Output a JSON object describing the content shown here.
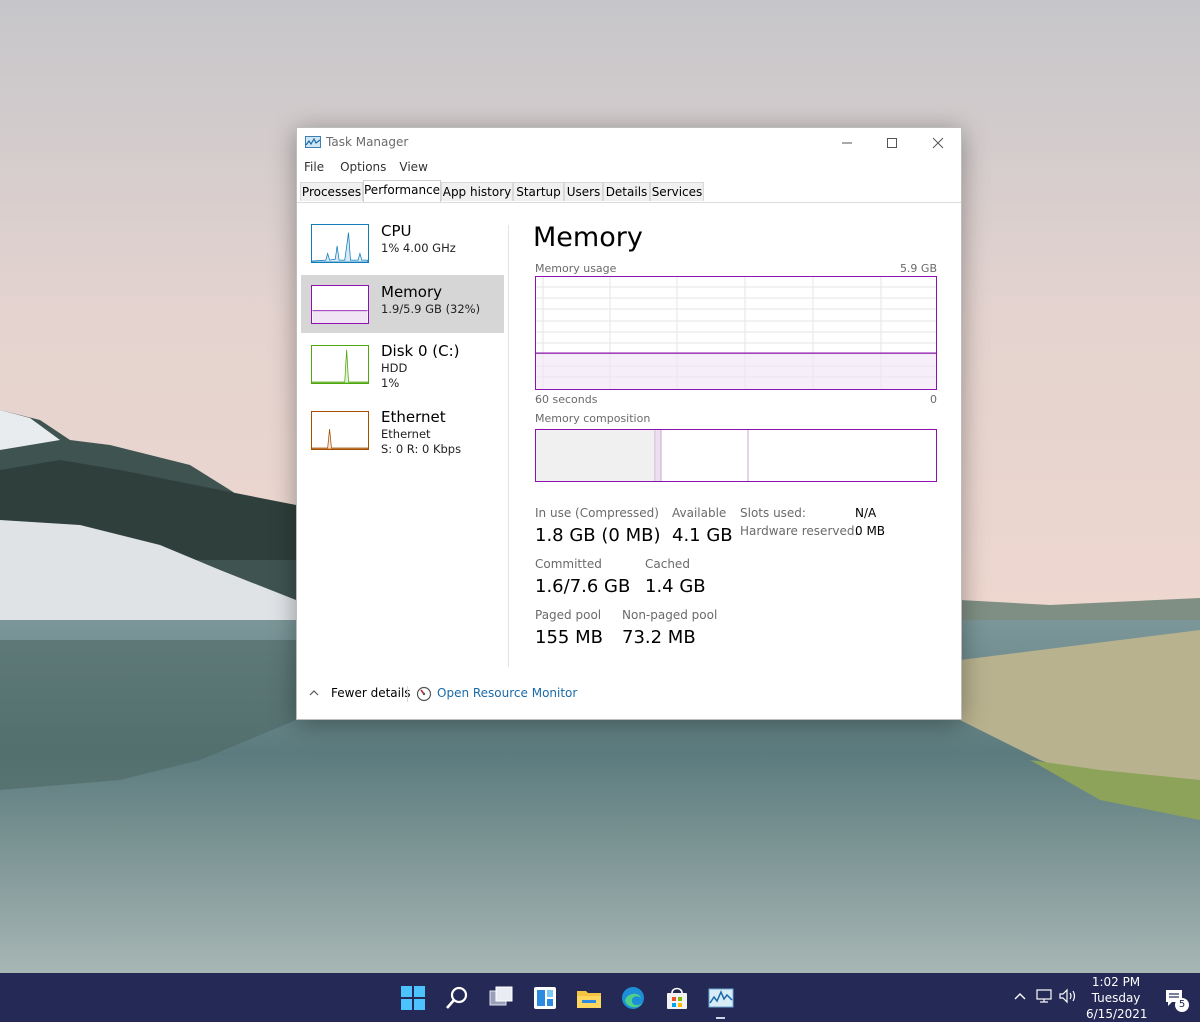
{
  "window": {
    "title": "Task Manager",
    "menu": [
      "File",
      "Options",
      "View"
    ],
    "tabs": [
      {
        "label": "Processes",
        "active": false
      },
      {
        "label": "Performance",
        "active": true
      },
      {
        "label": "App history",
        "active": false
      },
      {
        "label": "Startup",
        "active": false
      },
      {
        "label": "Users",
        "active": false
      },
      {
        "label": "Details",
        "active": false
      },
      {
        "label": "Services",
        "active": false
      }
    ]
  },
  "sidebar": {
    "items": [
      {
        "name": "CPU",
        "line1": "1% 4.00 GHz",
        "line2": "",
        "color": "#117dbb"
      },
      {
        "name": "Memory",
        "line1": "1.9/5.9 GB (32%)",
        "line2": "",
        "color": "#8b12ae",
        "selected": true
      },
      {
        "name": "Disk 0 (C:)",
        "line1": "HDD",
        "line2": "1%",
        "color": "#4da60c"
      },
      {
        "name": "Ethernet",
        "line1": "Ethernet",
        "line2": "S: 0 R: 0 Kbps",
        "color": "#a74f01"
      }
    ]
  },
  "main": {
    "title": "Memory",
    "usage_label": "Memory usage",
    "usage_max": "5.9 GB",
    "time_label": "60 seconds",
    "time_end": "0",
    "composition_label": "Memory composition",
    "usage_fraction": 0.32,
    "stats": {
      "in_use_label": "In use (Compressed)",
      "in_use_value": "1.8 GB (0 MB)",
      "available_label": "Available",
      "available_value": "4.1 GB",
      "slots_label": "Slots used:",
      "slots_value": "N/A",
      "hw_reserved_label": "Hardware reserved:",
      "hw_reserved_value": "0 MB",
      "committed_label": "Committed",
      "committed_value": "1.6/7.6 GB",
      "cached_label": "Cached",
      "cached_value": "1.4 GB",
      "paged_label": "Paged pool",
      "paged_value": "155 MB",
      "nonpaged_label": "Non-paged pool",
      "nonpaged_value": "73.2 MB"
    }
  },
  "footer": {
    "fewer_details": "Fewer details",
    "open_monitor": "Open Resource Monitor"
  },
  "taskbar": {
    "time": "1:02 PM",
    "day": "Tuesday",
    "date": "6/15/2021",
    "notification_count": "5"
  }
}
